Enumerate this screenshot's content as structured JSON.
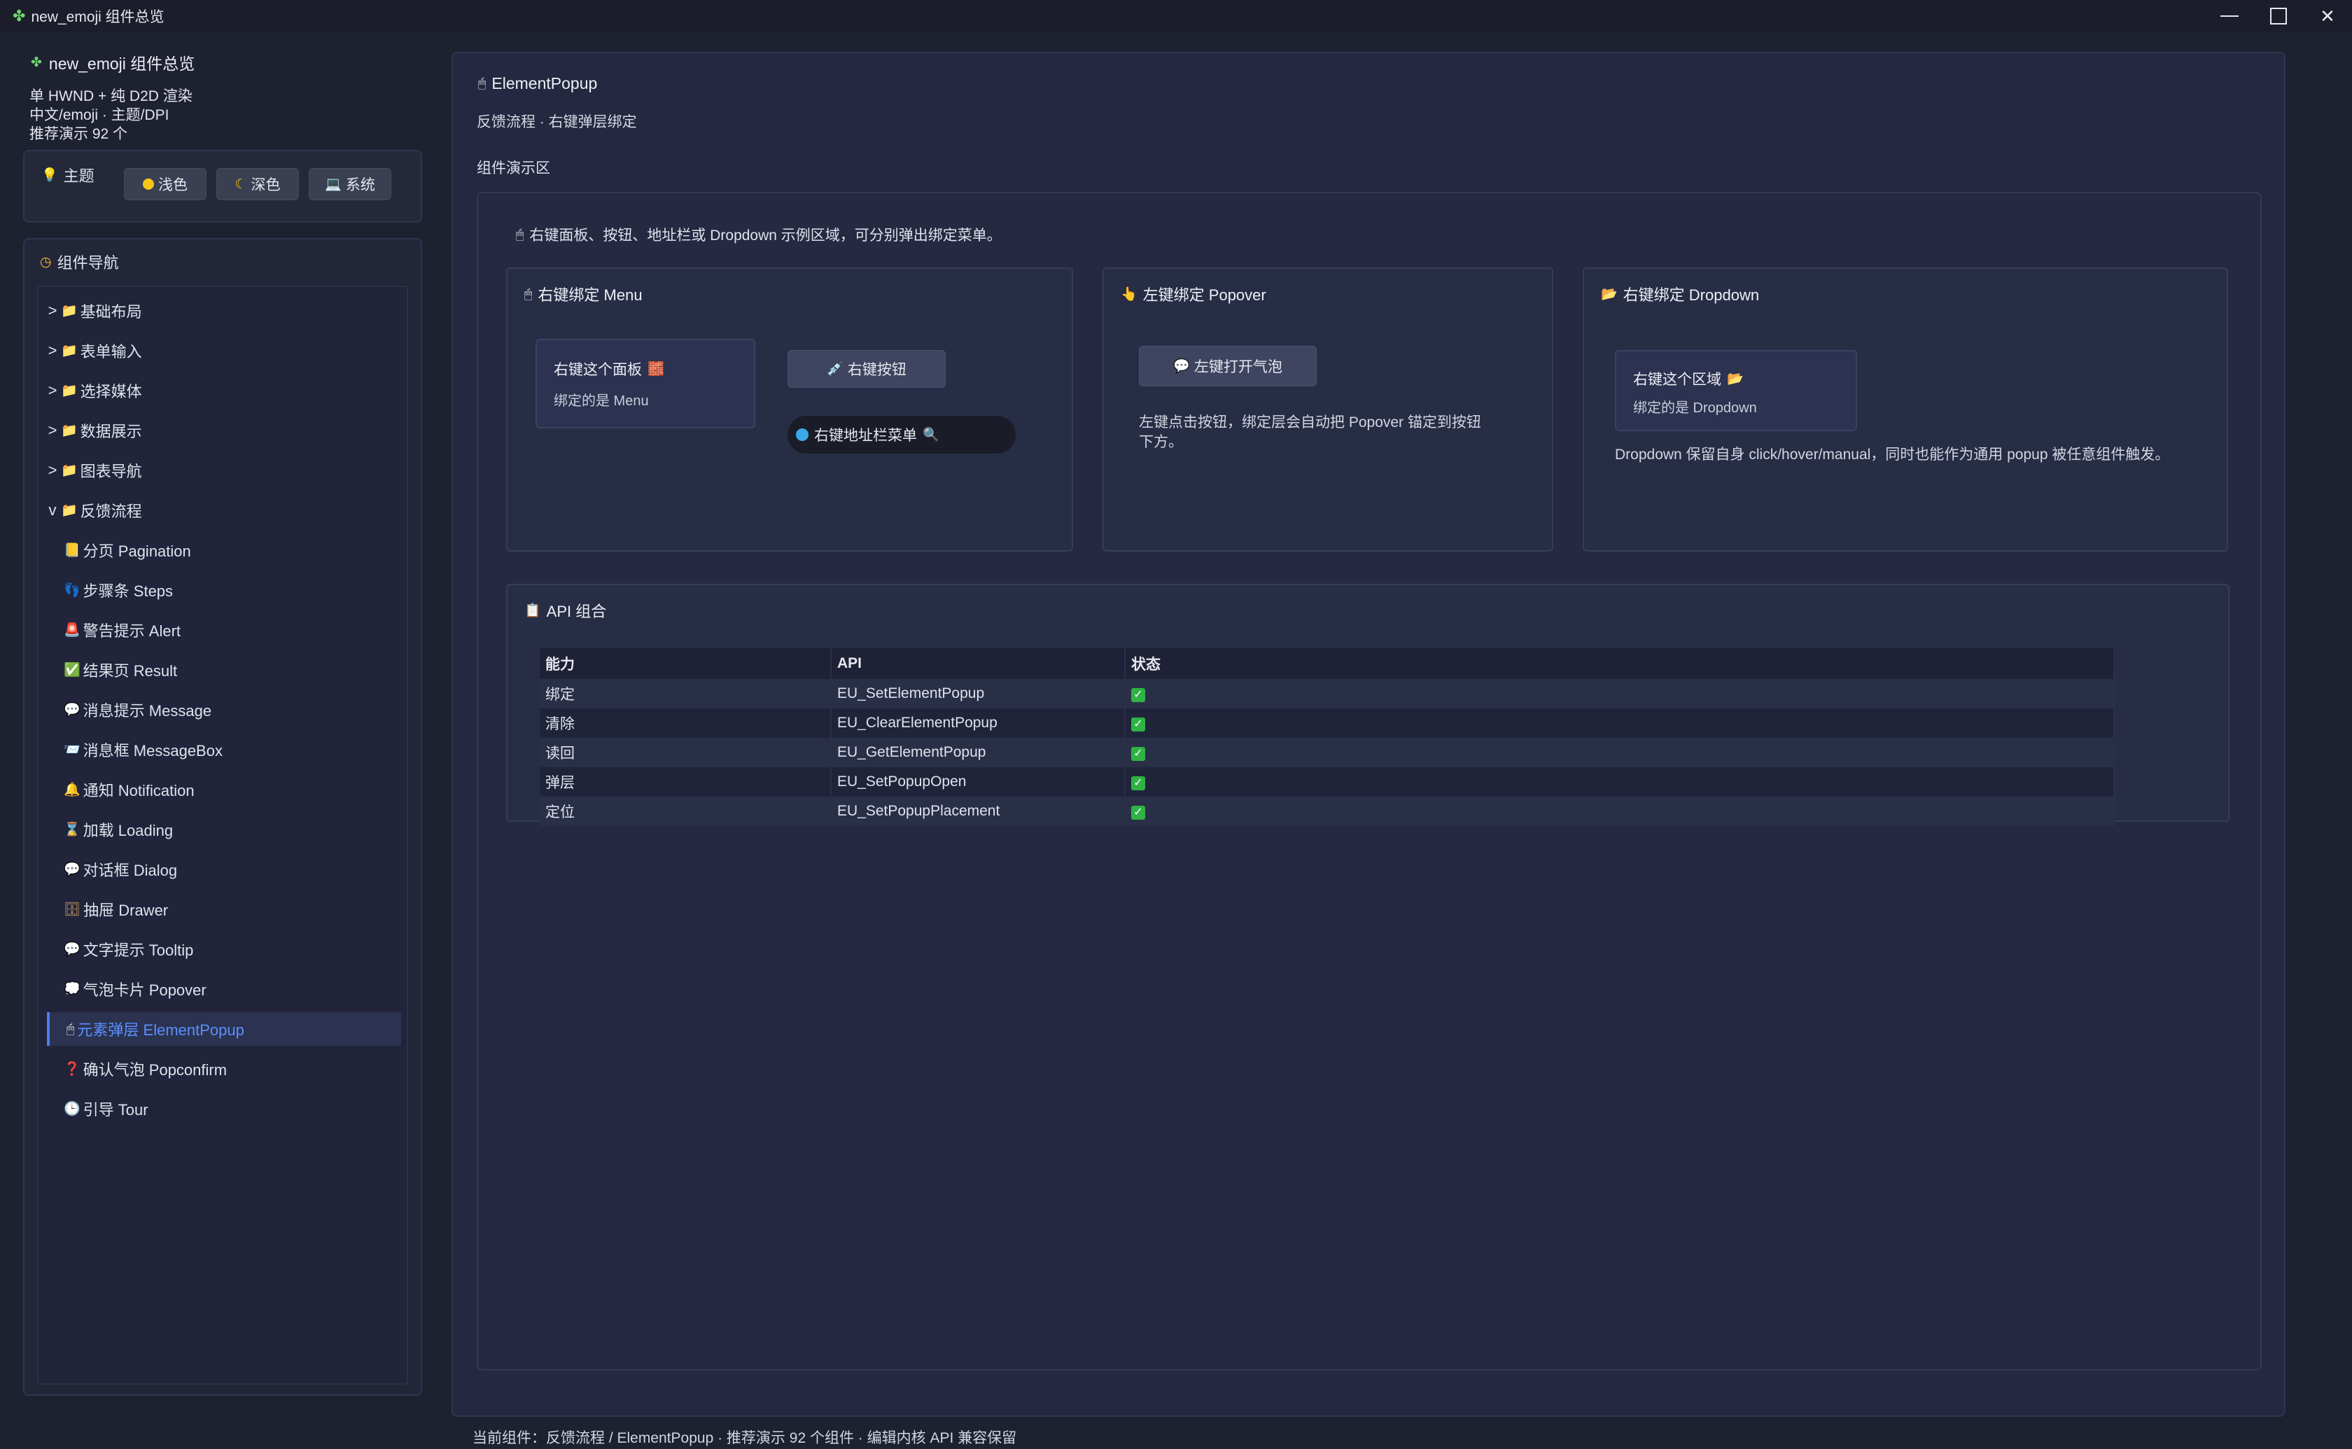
{
  "window": {
    "title": "new_emoji 组件总览"
  },
  "sidebar": {
    "title": "new_emoji 组件总览",
    "info": [
      "单 HWND + 纯 D2D 渲染",
      "中文/emoji · 主题/DPI",
      "推荐演示 92 个"
    ],
    "theme": {
      "label": "主题",
      "buttons": [
        {
          "label": "浅色",
          "icon": "yellow-circle-icon"
        },
        {
          "label": "深色",
          "icon": "crescent-moon-icon"
        },
        {
          "label": "系统",
          "icon": "laptop-icon"
        }
      ]
    },
    "nav_title": "组件导航",
    "nav": [
      {
        "label": "基础布局",
        "type": "group",
        "chev": ">",
        "icon": "folder-icon"
      },
      {
        "label": "表单输入",
        "type": "group",
        "chev": ">",
        "icon": "folder-icon"
      },
      {
        "label": "选择媒体",
        "type": "group",
        "chev": ">",
        "icon": "folder-icon"
      },
      {
        "label": "数据展示",
        "type": "group",
        "chev": ">",
        "icon": "folder-icon"
      },
      {
        "label": "图表导航",
        "type": "group",
        "chev": ">",
        "icon": "folder-icon"
      },
      {
        "label": "反馈流程",
        "type": "group",
        "chev": "v",
        "icon": "folder-icon"
      },
      {
        "label": "分页 Pagination",
        "icon": "book-icon"
      },
      {
        "label": "步骤条 Steps",
        "icon": "footprints-icon"
      },
      {
        "label": "警告提示 Alert",
        "icon": "siren-icon"
      },
      {
        "label": "结果页 Result",
        "icon": "check-box-icon"
      },
      {
        "label": "消息提示 Message",
        "icon": "speech-icon"
      },
      {
        "label": "消息框 MessageBox",
        "icon": "message-box-icon"
      },
      {
        "label": "通知 Notification",
        "icon": "bell-icon"
      },
      {
        "label": "加载 Loading",
        "icon": "hourglass-icon"
      },
      {
        "label": "对话框 Dialog",
        "icon": "dialog-icon"
      },
      {
        "label": "抽屉 Drawer",
        "icon": "drawer-icon"
      },
      {
        "label": "文字提示 Tooltip",
        "icon": "speech-bubble-icon"
      },
      {
        "label": "气泡卡片 Popover",
        "icon": "thought-bubble-icon"
      },
      {
        "label": "元素弹层 ElementPopup",
        "icon": "mouse-icon",
        "active": true
      },
      {
        "label": "确认气泡 Popconfirm",
        "icon": "question-icon"
      },
      {
        "label": "引导 Tour",
        "icon": "clock-icon"
      }
    ]
  },
  "main": {
    "title": "ElementPopup",
    "subtitle": "反馈流程 · 右键弹层绑定",
    "demo_label": "组件演示区",
    "demo_hint": "右键面板、按钮、地址栏或 Dropdown 示例区域，可分别弹出绑定菜单。",
    "card_menu": {
      "title": "右键绑定 Menu",
      "panel_line1": "右键这个面板",
      "panel_line2": "绑定的是 Menu",
      "button": "右键按钮",
      "address": "右键地址栏菜单"
    },
    "card_popover": {
      "title": "左键绑定 Popover",
      "button": "左键打开气泡",
      "desc_lines": [
        "左键点击按钮，绑定层会自动把 Popover 锚定到按钮",
        "下方。"
      ]
    },
    "card_dropdown": {
      "title": "右键绑定 Dropdown",
      "panel_line1": "右键这个区域",
      "panel_line2": "绑定的是 Dropdown",
      "desc": "Dropdown 保留自身 click/hover/manual，同时也能作为通用 popup 被任意组件触发。"
    },
    "api": {
      "title": "API 组合",
      "headers": [
        "能力",
        "API",
        "状态"
      ],
      "rows": [
        [
          "绑定",
          "EU_SetElementPopup"
        ],
        [
          "清除",
          "EU_ClearElementPopup"
        ],
        [
          "读回",
          "EU_GetElementPopup"
        ],
        [
          "弹层",
          "EU_SetPopupOpen"
        ],
        [
          "定位",
          "EU_SetPopupPlacement"
        ]
      ]
    }
  },
  "status_bar": "当前组件：反馈流程 / ElementPopup · 推荐演示 92 个组件 · 编辑内核 API 兼容保留",
  "colors": {
    "accent": "#4d7cf0",
    "background": "#1e2130",
    "panel": "#242840",
    "check": "#2fb344"
  }
}
